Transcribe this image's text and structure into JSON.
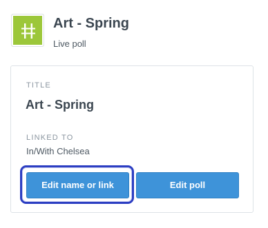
{
  "header": {
    "title": "Art - Spring",
    "subtitle": "Live poll",
    "icon": "hashtag-icon",
    "icon_color": "#9cc73a"
  },
  "card": {
    "title_label": "TITLE",
    "title_value": "Art - Spring",
    "linked_label": "LINKED TO",
    "linked_value": "In/With Chelsea"
  },
  "buttons": {
    "edit_name_label": "Edit name or link",
    "edit_poll_label": "Edit poll",
    "color": "#3e93d9",
    "focused": "edit_name"
  }
}
